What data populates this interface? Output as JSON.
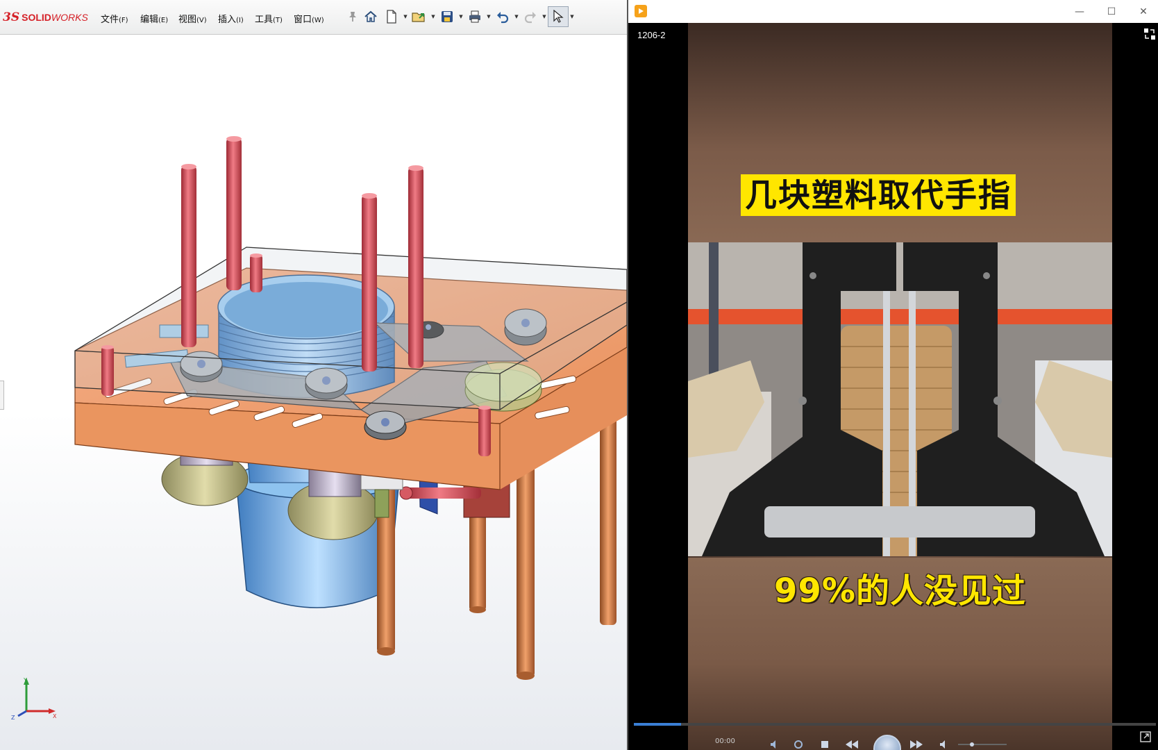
{
  "solidworks": {
    "logo_ds": "3S",
    "logo_solid": "SOLID",
    "logo_works": "WORKS",
    "menus": [
      {
        "label": "文件",
        "key": "(F)"
      },
      {
        "label": "编辑",
        "key": "(E)"
      },
      {
        "label": "视图",
        "key": "(V)"
      },
      {
        "label": "插入",
        "key": "(I)"
      },
      {
        "label": "工具",
        "key": "(T)"
      },
      {
        "label": "窗口",
        "key": "(W)"
      }
    ],
    "toolbar_icons": [
      "home-icon",
      "new-document-icon",
      "open-folder-icon",
      "save-icon",
      "print-icon",
      "undo-icon",
      "redo-icon",
      "select-cursor-icon"
    ],
    "triad_labels": {
      "x": "X",
      "y": "Y",
      "z": "Z"
    },
    "colors": {
      "logo_red": "#d52027",
      "plate_orange": "#ed9a6b",
      "rod_red": "#d9505a",
      "drum_blue": "#7fb6e8",
      "leg_copper": "#c8733f"
    }
  },
  "video_player": {
    "file_name": "1206-2",
    "title_buttons": [
      "minimize-icon",
      "maximize-icon",
      "close-icon"
    ],
    "caption_top": "几块塑料取代手指",
    "caption_bottom": "99%的人没见过",
    "time_current": "00:00",
    "progress": 0.09,
    "colors": {
      "caption_bg": "#ffe600",
      "caption_text": "#111111",
      "progress": "#3a7fd5"
    }
  }
}
